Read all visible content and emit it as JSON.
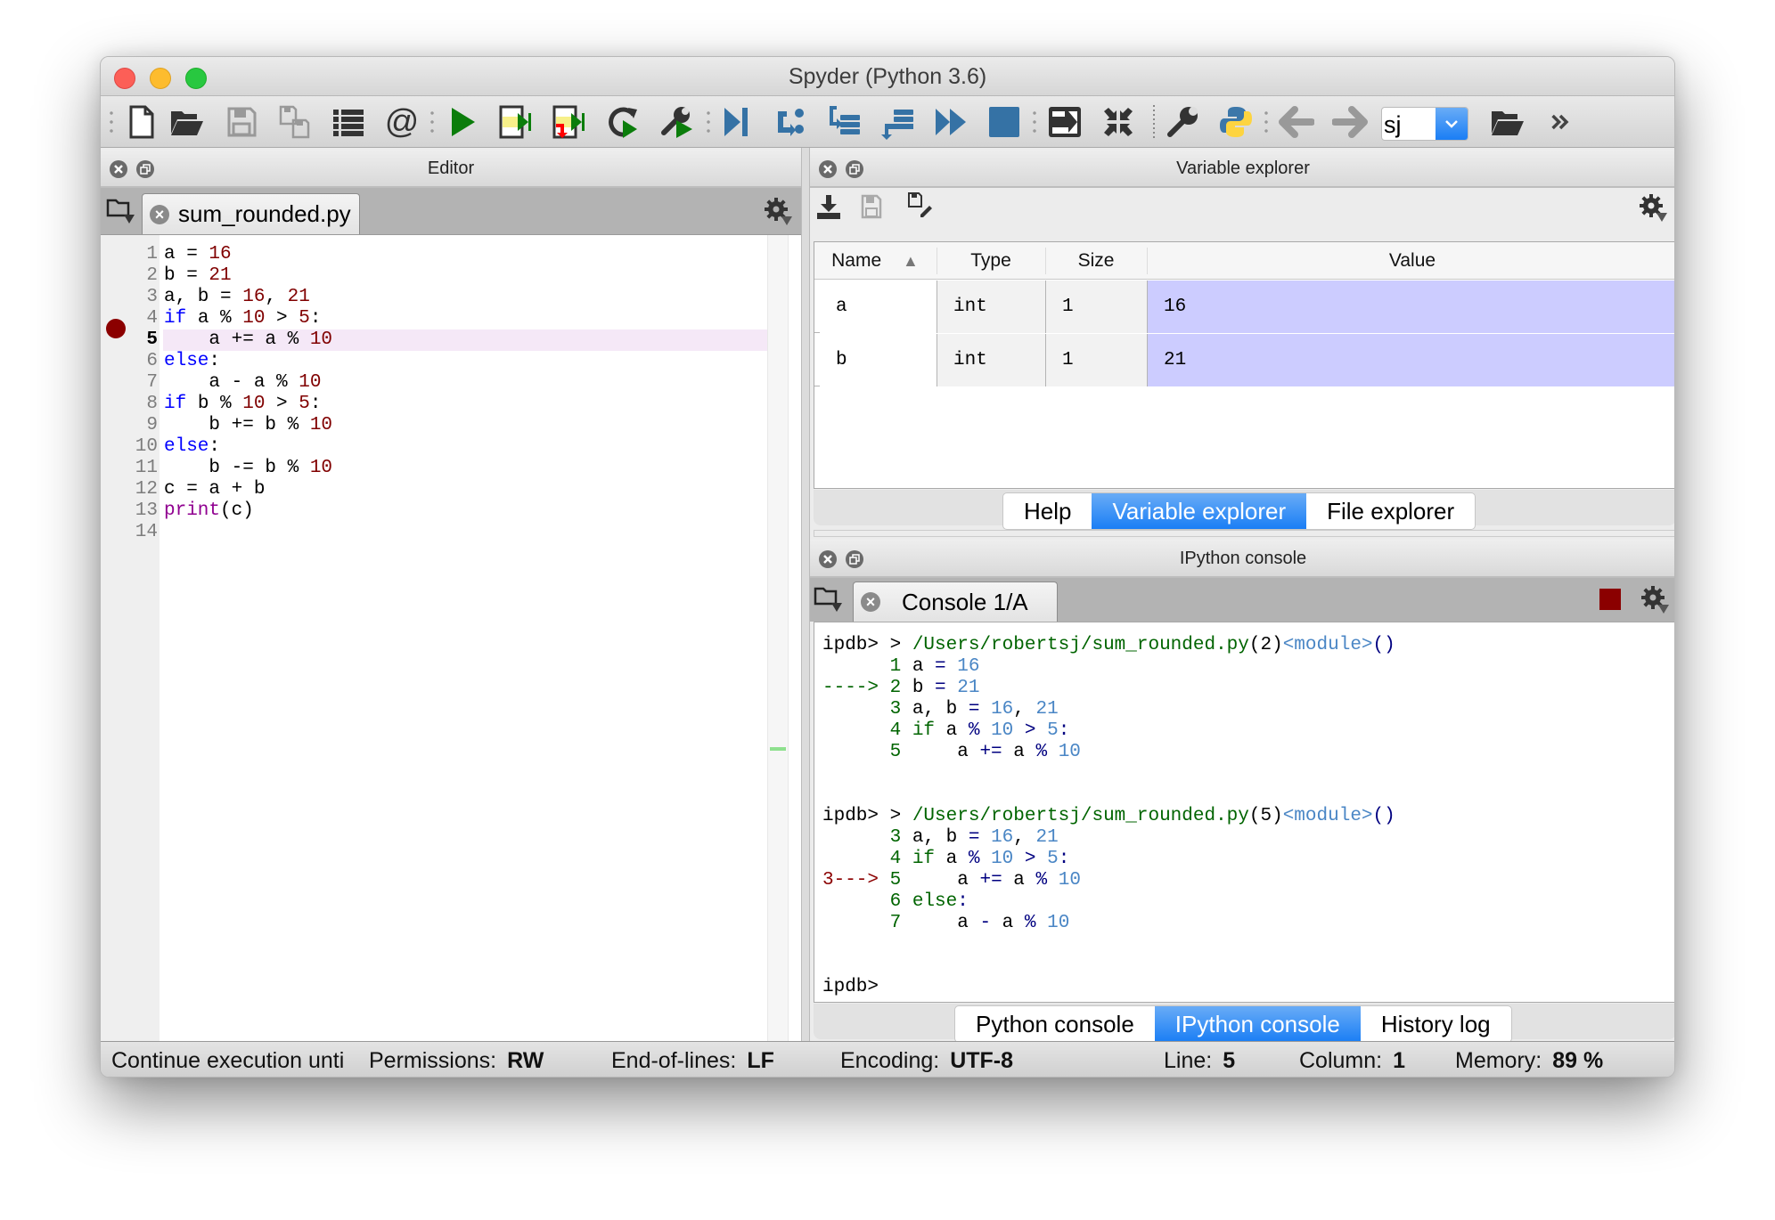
{
  "window": {
    "title": "Spyder (Python 3.6)"
  },
  "toolbar": {
    "buttons": [
      {
        "icon": "new-file-icon",
        "label": "New file"
      },
      {
        "icon": "open-folder-icon",
        "label": "Open file"
      },
      {
        "icon": "save-icon",
        "label": "Save file"
      },
      {
        "icon": "save-all-icon",
        "label": "Save all"
      },
      {
        "icon": "list-icon",
        "label": "Browse tabs"
      },
      {
        "icon": "at-icon",
        "label": "Symbol finder"
      },
      {
        "icon": "run-icon",
        "label": "Run file"
      },
      {
        "icon": "run-cell-icon",
        "label": "Run cell"
      },
      {
        "icon": "run-cell-advance-icon",
        "label": "Run cell and advance"
      },
      {
        "icon": "rerun-icon",
        "label": "Re-run last script"
      },
      {
        "icon": "run-config-icon",
        "label": "Configure run"
      },
      {
        "icon": "debug-icon",
        "label": "Debug file"
      },
      {
        "icon": "step-icon",
        "label": "Run current line"
      },
      {
        "icon": "step-into-icon",
        "label": "Step into function"
      },
      {
        "icon": "step-return-icon",
        "label": "Run until return"
      },
      {
        "icon": "continue-icon",
        "label": "Continue execution"
      },
      {
        "icon": "stop-icon",
        "label": "Stop debugging"
      },
      {
        "icon": "maximize-pane-icon",
        "label": "Maximize current pane"
      },
      {
        "icon": "fullscreen-icon",
        "label": "Fullscreen mode"
      },
      {
        "icon": "wrench-icon",
        "label": "Preferences"
      },
      {
        "icon": "python-icon",
        "label": "PYTHONPATH manager"
      },
      {
        "icon": "arrow-left-icon",
        "label": "Back"
      },
      {
        "icon": "arrow-right-icon",
        "label": "Forward"
      },
      {
        "icon": "open-folder-icon",
        "label": "Browse working directory"
      },
      {
        "icon": "chevron-double-right-icon",
        "label": "More"
      }
    ],
    "working_dir": "sj"
  },
  "editor": {
    "pane_title": "Editor",
    "tab_label": "sum_rounded.py",
    "current_line": 5,
    "breakpoint_line": 4,
    "lines": [
      {
        "n": "1",
        "tokens": [
          [
            "a = ",
            ""
          ],
          [
            "16",
            "num"
          ]
        ]
      },
      {
        "n": "2",
        "tokens": [
          [
            "b = ",
            ""
          ],
          [
            "21",
            "num"
          ]
        ]
      },
      {
        "n": "3",
        "tokens": [
          [
            "a, b = ",
            ""
          ],
          [
            "16",
            "num"
          ],
          [
            ", ",
            ""
          ],
          [
            "21",
            "num"
          ]
        ]
      },
      {
        "n": "4",
        "tokens": [
          [
            "if",
            "kw"
          ],
          [
            " a % ",
            ""
          ],
          [
            "10",
            "num"
          ],
          [
            " > ",
            ""
          ],
          [
            "5",
            "num"
          ],
          [
            ":",
            ""
          ]
        ]
      },
      {
        "n": "5",
        "tokens": [
          [
            "    a += a % ",
            ""
          ],
          [
            "10",
            "num"
          ]
        ]
      },
      {
        "n": "6",
        "tokens": [
          [
            "else",
            "kw"
          ],
          [
            ":",
            ""
          ]
        ]
      },
      {
        "n": "7",
        "tokens": [
          [
            "    a - a % ",
            ""
          ],
          [
            "10",
            "num"
          ]
        ]
      },
      {
        "n": "8",
        "tokens": [
          [
            "if",
            "kw"
          ],
          [
            " b % ",
            ""
          ],
          [
            "10",
            "num"
          ],
          [
            " > ",
            ""
          ],
          [
            "5",
            "num"
          ],
          [
            ":",
            ""
          ]
        ]
      },
      {
        "n": "9",
        "tokens": [
          [
            "    b += b % ",
            ""
          ],
          [
            "10",
            "num"
          ]
        ]
      },
      {
        "n": "10",
        "tokens": [
          [
            "else",
            "kw"
          ],
          [
            ":",
            ""
          ]
        ]
      },
      {
        "n": "11",
        "tokens": [
          [
            "    b -= b % ",
            ""
          ],
          [
            "10",
            "num"
          ]
        ]
      },
      {
        "n": "12",
        "tokens": [
          [
            "c = a + b",
            ""
          ]
        ]
      },
      {
        "n": "13",
        "tokens": [
          [
            "print",
            "builtin"
          ],
          [
            "(c)",
            ""
          ]
        ]
      },
      {
        "n": "14",
        "tokens": []
      }
    ]
  },
  "variable_explorer": {
    "pane_title": "Variable explorer",
    "columns": [
      "Name",
      "Type",
      "Size",
      "Value"
    ],
    "sort_indicator": "▲",
    "rows": [
      {
        "name": "a",
        "type": "int",
        "size": "1",
        "value": "16"
      },
      {
        "name": "b",
        "type": "int",
        "size": "1",
        "value": "21"
      }
    ],
    "value_highlight_color": "#ccccff",
    "tabs": [
      {
        "label": "Help",
        "active": false
      },
      {
        "label": "Variable explorer",
        "active": true
      },
      {
        "label": "File explorer",
        "active": false
      }
    ]
  },
  "ipython": {
    "pane_title": "IPython console",
    "tab_label": "Console 1/A",
    "output": [
      [
        [
          "ipdb> > ",
          ""
        ],
        [
          "/Users/robertsj/sum_rounded.py",
          "c-green"
        ],
        [
          "(2)",
          ""
        ],
        [
          "<module>",
          "c-blue"
        ],
        [
          "()",
          "c-navy"
        ]
      ],
      [
        [
          "      1 ",
          "c-lnum"
        ],
        [
          "a ",
          ""
        ],
        [
          "= ",
          "c-navy"
        ],
        [
          "16",
          "c-blue"
        ]
      ],
      [
        [
          "----> 2 ",
          "c-lnum"
        ],
        [
          "b ",
          ""
        ],
        [
          "= ",
          "c-navy"
        ],
        [
          "21",
          "c-blue"
        ]
      ],
      [
        [
          "      3 ",
          "c-lnum"
        ],
        [
          "a, b ",
          ""
        ],
        [
          "= ",
          "c-navy"
        ],
        [
          "16",
          "c-blue"
        ],
        [
          ", ",
          ""
        ],
        [
          "21",
          "c-blue"
        ]
      ],
      [
        [
          "      4 ",
          "c-lnum"
        ],
        [
          "if ",
          "c-green"
        ],
        [
          "a ",
          ""
        ],
        [
          "% ",
          "c-navy"
        ],
        [
          "10",
          "c-blue"
        ],
        [
          " > ",
          "c-navy"
        ],
        [
          "5",
          "c-blue"
        ],
        [
          ":",
          "c-navy"
        ]
      ],
      [
        [
          "      5     ",
          "c-lnum"
        ],
        [
          "a ",
          ""
        ],
        [
          "+= ",
          "c-navy"
        ],
        [
          "a ",
          ""
        ],
        [
          "% ",
          "c-navy"
        ],
        [
          "10",
          "c-blue"
        ]
      ],
      [],
      [],
      [
        [
          "ipdb> > ",
          ""
        ],
        [
          "/Users/robertsj/sum_rounded.py",
          "c-green"
        ],
        [
          "(5)",
          ""
        ],
        [
          "<module>",
          "c-blue"
        ],
        [
          "()",
          "c-navy"
        ]
      ],
      [
        [
          "      3 ",
          "c-lnum"
        ],
        [
          "a, b ",
          ""
        ],
        [
          "= ",
          "c-navy"
        ],
        [
          "16",
          "c-blue"
        ],
        [
          ", ",
          ""
        ],
        [
          "21",
          "c-blue"
        ]
      ],
      [
        [
          "      4 ",
          "c-lnum"
        ],
        [
          "if ",
          "c-green"
        ],
        [
          "a ",
          ""
        ],
        [
          "% ",
          "c-navy"
        ],
        [
          "10",
          "c-blue"
        ],
        [
          " > ",
          "c-navy"
        ],
        [
          "5",
          "c-blue"
        ],
        [
          ":",
          "c-navy"
        ]
      ],
      [
        [
          "3---> ",
          "c-red"
        ],
        [
          "5     ",
          "c-lnum"
        ],
        [
          "a ",
          ""
        ],
        [
          "+= ",
          "c-navy"
        ],
        [
          "a ",
          ""
        ],
        [
          "% ",
          "c-navy"
        ],
        [
          "10",
          "c-blue"
        ]
      ],
      [
        [
          "      6 ",
          "c-lnum"
        ],
        [
          "else",
          "c-green"
        ],
        [
          ":",
          "c-navy"
        ]
      ],
      [
        [
          "      7     ",
          "c-lnum"
        ],
        [
          "a ",
          ""
        ],
        [
          "- ",
          "c-navy"
        ],
        [
          "a ",
          ""
        ],
        [
          "% ",
          "c-navy"
        ],
        [
          "10",
          "c-blue"
        ]
      ],
      [],
      [],
      [
        [
          "ipdb> ",
          ""
        ]
      ]
    ],
    "tabs": [
      {
        "label": "Python console",
        "active": false
      },
      {
        "label": "IPython console",
        "active": true
      },
      {
        "label": "History log",
        "active": false
      }
    ]
  },
  "statusbar": {
    "message": "Continue execution unti",
    "permissions_label": "Permissions:",
    "permissions_value": "RW",
    "eol_label": "End-of-lines:",
    "eol_value": "LF",
    "encoding_label": "Encoding:",
    "encoding_value": "UTF-8",
    "line_label": "Line:",
    "line_value": "5",
    "column_label": "Column:",
    "column_value": "1",
    "memory_label": "Memory:",
    "memory_value": "89 %"
  },
  "colors": {
    "accent": "#1a7ef5",
    "breakpoint": "#8b0000",
    "current_line_bg": "#f5e8f7",
    "keyword": "#0000ff",
    "number": "#800000"
  }
}
